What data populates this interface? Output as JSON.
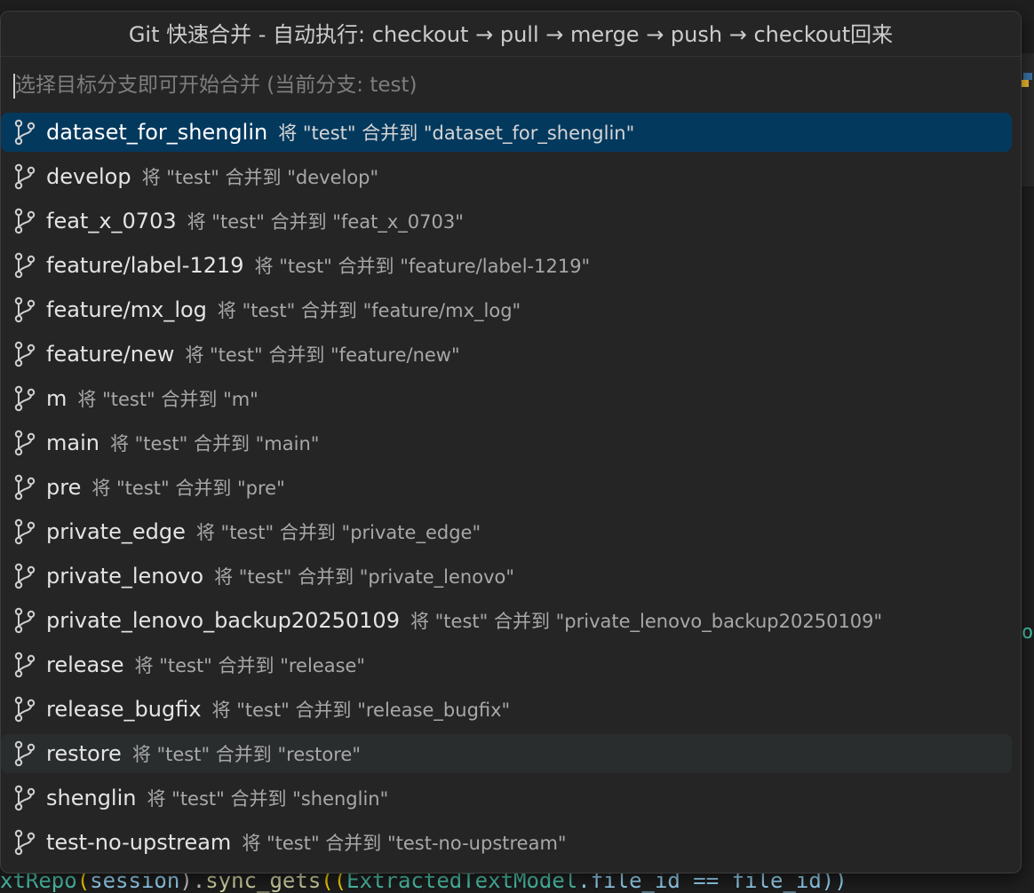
{
  "dialog": {
    "title": "Git 快速合并 - 自动执行: checkout → pull → merge → push → checkout回来",
    "placeholder": "选择目标分支即可开始合并 (当前分支: test)"
  },
  "branches": [
    {
      "name": "dataset_for_shenglin",
      "desc": "将 \"test\" 合并到 \"dataset_for_shenglin\"",
      "state": "selected"
    },
    {
      "name": "develop",
      "desc": "将 \"test\" 合并到 \"develop\"",
      "state": ""
    },
    {
      "name": "feat_x_0703",
      "desc": "将 \"test\" 合并到 \"feat_x_0703\"",
      "state": ""
    },
    {
      "name": "feature/label-1219",
      "desc": "将 \"test\" 合并到 \"feature/label-1219\"",
      "state": ""
    },
    {
      "name": "feature/mx_log",
      "desc": "将 \"test\" 合并到 \"feature/mx_log\"",
      "state": ""
    },
    {
      "name": "feature/new",
      "desc": "将 \"test\" 合并到 \"feature/new\"",
      "state": ""
    },
    {
      "name": "m",
      "desc": "将 \"test\" 合并到 \"m\"",
      "state": ""
    },
    {
      "name": "main",
      "desc": "将 \"test\" 合并到 \"main\"",
      "state": ""
    },
    {
      "name": "pre",
      "desc": "将 \"test\" 合并到 \"pre\"",
      "state": ""
    },
    {
      "name": "private_edge",
      "desc": "将 \"test\" 合并到 \"private_edge\"",
      "state": ""
    },
    {
      "name": "private_lenovo",
      "desc": "将 \"test\" 合并到 \"private_lenovo\"",
      "state": ""
    },
    {
      "name": "private_lenovo_backup20250109",
      "desc": "将 \"test\" 合并到 \"private_lenovo_backup20250109\"",
      "state": ""
    },
    {
      "name": "release",
      "desc": "将 \"test\" 合并到 \"release\"",
      "state": ""
    },
    {
      "name": "release_bugfix",
      "desc": "将 \"test\" 合并到 \"release_bugfix\"",
      "state": ""
    },
    {
      "name": "restore",
      "desc": "将 \"test\" 合并到 \"restore\"",
      "state": "hovered"
    },
    {
      "name": "shenglin",
      "desc": "将 \"test\" 合并到 \"shenglin\"",
      "state": ""
    },
    {
      "name": "test-no-upstream",
      "desc": "将 \"test\" 合并到 \"test-no-upstream\"",
      "state": ""
    }
  ],
  "background_editor": {
    "code_line": {
      "part1": "xtRepo",
      "part2": "(",
      "part3": "session",
      "part4": ").",
      "part5": "sync_gets",
      "part6": "((",
      "part7": "ExtractedTextModel",
      "part8": ".file_id == file_id))"
    },
    "right_text": "op"
  },
  "colors": {
    "selected_bg": "#04395e",
    "hover_bg": "#2a2d2e",
    "dialog_bg": "#252526"
  },
  "icons": {
    "branch": "git-branch-icon"
  }
}
